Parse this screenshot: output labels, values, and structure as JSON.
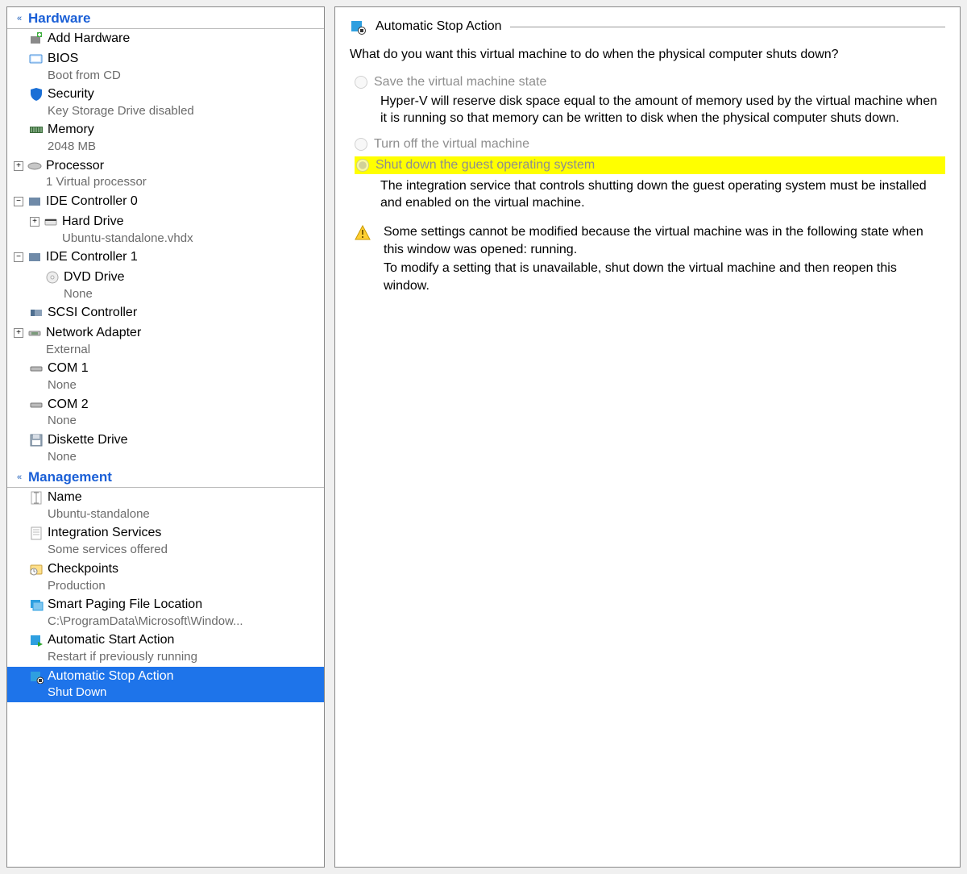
{
  "sidebar": {
    "sections": {
      "hardware": "Hardware",
      "management": "Management"
    },
    "hardware_items": [
      {
        "label": "Add Hardware",
        "sub": ""
      },
      {
        "label": "BIOS",
        "sub": "Boot from CD"
      },
      {
        "label": "Security",
        "sub": "Key Storage Drive disabled"
      },
      {
        "label": "Memory",
        "sub": "2048 MB"
      },
      {
        "label": "Processor",
        "sub": "1 Virtual processor"
      },
      {
        "label": "IDE Controller 0",
        "sub": ""
      },
      {
        "label": "Hard Drive",
        "sub": "Ubuntu-standalone.vhdx"
      },
      {
        "label": "IDE Controller 1",
        "sub": ""
      },
      {
        "label": "DVD Drive",
        "sub": "None"
      },
      {
        "label": "SCSI Controller",
        "sub": ""
      },
      {
        "label": "Network Adapter",
        "sub": "External"
      },
      {
        "label": "COM 1",
        "sub": "None"
      },
      {
        "label": "COM 2",
        "sub": "None"
      },
      {
        "label": "Diskette Drive",
        "sub": "None"
      }
    ],
    "management_items": [
      {
        "label": "Name",
        "sub": "Ubuntu-standalone"
      },
      {
        "label": "Integration Services",
        "sub": "Some services offered"
      },
      {
        "label": "Checkpoints",
        "sub": "Production"
      },
      {
        "label": "Smart Paging File Location",
        "sub": "C:\\ProgramData\\Microsoft\\Window..."
      },
      {
        "label": "Automatic Start Action",
        "sub": "Restart if previously running"
      },
      {
        "label": "Automatic Stop Action",
        "sub": "Shut Down"
      }
    ]
  },
  "panel": {
    "title": "Automatic Stop Action",
    "question": "What do you want this virtual machine to do when the physical computer shuts down?",
    "options": [
      {
        "label": "Save the virtual machine state",
        "desc": "Hyper-V will reserve disk space equal to the amount of memory used by the virtual machine when it is running so that memory can be written to disk when the physical computer shuts down."
      },
      {
        "label": "Turn off the virtual machine",
        "desc": ""
      },
      {
        "label": "Shut down the guest operating system",
        "desc": "The integration service that controls shutting down the guest operating system must be installed and enabled on the virtual machine."
      }
    ],
    "warning": "Some settings cannot be modified because the virtual machine was in the following state when this window was opened: running.\nTo modify a setting that is unavailable, shut down the virtual machine and then reopen this window."
  }
}
